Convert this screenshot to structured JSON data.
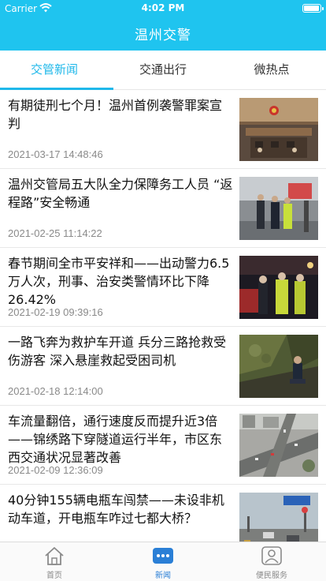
{
  "status_bar": {
    "carrier": "Carrier",
    "time": "4:02 PM"
  },
  "nav": {
    "title": "温州交警"
  },
  "tabs": [
    {
      "label": "交管新闻",
      "active": true
    },
    {
      "label": "交通出行",
      "active": false
    },
    {
      "label": "微热点",
      "active": false
    }
  ],
  "news": [
    {
      "title": "有期徒刑七个月！温州首例袭警罪案宣判",
      "date": "2021-03-17 14:48:46",
      "image": "courtroom-photo"
    },
    {
      "title": "温州交管局五大队全力保障务工人员 “返程路”安全畅通",
      "date": "2021-02-25 11:14:22",
      "image": "police-checkpoint-photo"
    },
    {
      "title": "春节期间全市平安祥和——出动警力6.5万人次，刑事、治安类警情环比下降26.42%",
      "date": "2021-02-19 09:39:16",
      "image": "night-patrol-photo"
    },
    {
      "title": "一路飞奔为救护车开道 兵分三路抢救受伤游客 深入悬崖救起受困司机",
      "date": "2021-02-18 12:14:00",
      "image": "cliff-rescue-photo"
    },
    {
      "title": "车流量翻倍，通行速度反而提升近3倍——锦绣路下穿隧道运行半年，市区东西交通状况显著改善",
      "date": "2021-02-09 12:36:09",
      "image": "aerial-road-photo"
    },
    {
      "title": "40分钟155辆电瓶车闯禁——未设非机动车道，开电瓶车咋过七都大桥？",
      "date": "",
      "image": "bridge-road-photo"
    }
  ],
  "tabbar": [
    {
      "label": "首页",
      "icon": "home-icon",
      "active": false
    },
    {
      "label": "新闻",
      "icon": "news-icon",
      "active": true
    },
    {
      "label": "便民服务",
      "icon": "service-icon",
      "active": false
    }
  ],
  "colors": {
    "header": "#1fc4ef",
    "tab_active": "#1fb8ea",
    "tabbar_active": "#2a7fd6"
  }
}
